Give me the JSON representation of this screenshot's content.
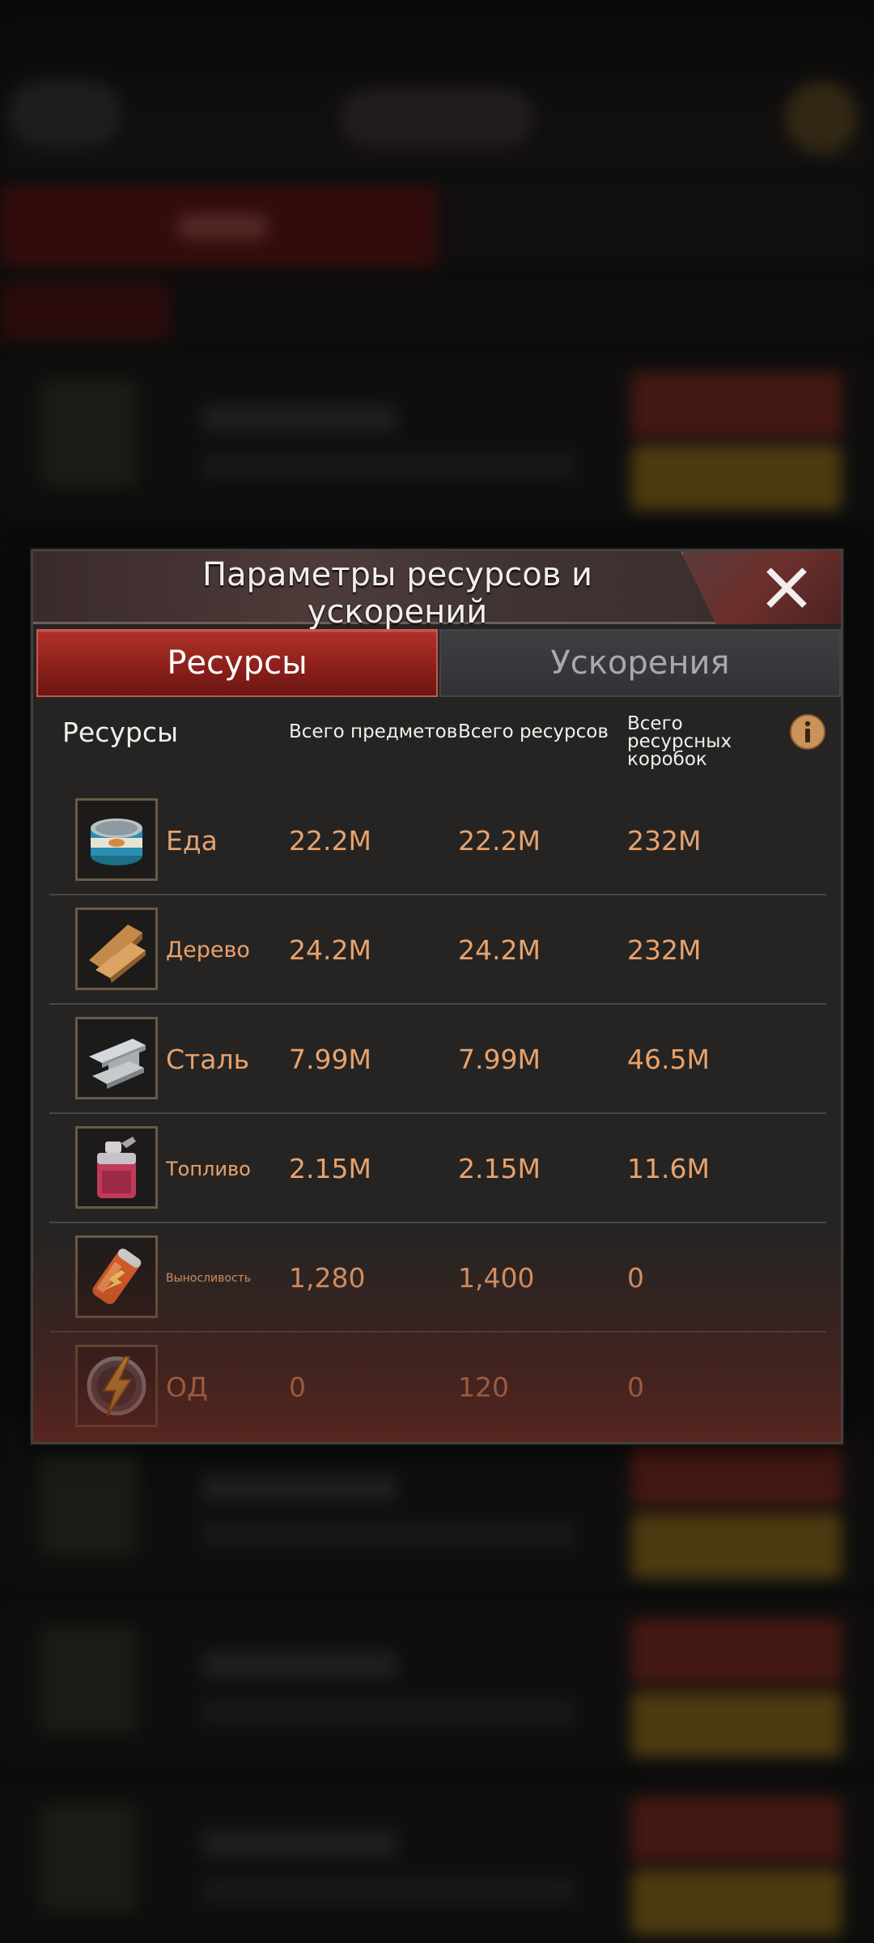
{
  "dialog": {
    "title": "Параметры ресурсов и ускорений",
    "close_icon": "close-icon",
    "tabs": [
      {
        "label": "Ресурсы",
        "active": true
      },
      {
        "label": "Ускорения",
        "active": false
      }
    ],
    "table": {
      "headers": {
        "resource": "Ресурсы",
        "total_items": "Всего предметов",
        "total_resources": "Всего ресурсов",
        "total_boxes": "Всего ресурсных коробок"
      },
      "info_icon": "info-icon",
      "rows": [
        {
          "name": "Еда",
          "icon": "canned-food-icon",
          "items": "22.2M",
          "resources": "22.2M",
          "boxes": "232M"
        },
        {
          "name": "Дерево",
          "icon": "wood-planks-icon",
          "items": "24.2M",
          "resources": "24.2M",
          "boxes": "232M"
        },
        {
          "name": "Сталь",
          "icon": "steel-beam-icon",
          "items": "7.99M",
          "resources": "7.99M",
          "boxes": "46.5M"
        },
        {
          "name": "Топливо",
          "icon": "fuel-canister-icon",
          "items": "2.15M",
          "resources": "2.15M",
          "boxes": "11.6M"
        },
        {
          "name": "Выносливость",
          "icon": "energy-drink-icon",
          "items": "1,280",
          "resources": "1,400",
          "boxes": "0"
        },
        {
          "name": "ОД",
          "icon": "lightning-bolt-icon",
          "items": "0",
          "resources": "120",
          "boxes": "0"
        }
      ]
    }
  },
  "colors": {
    "value_text": "#e8a26d",
    "active_tab": "#8d201c",
    "inactive_tab": "#37363a",
    "panel_bg": "#252423"
  }
}
